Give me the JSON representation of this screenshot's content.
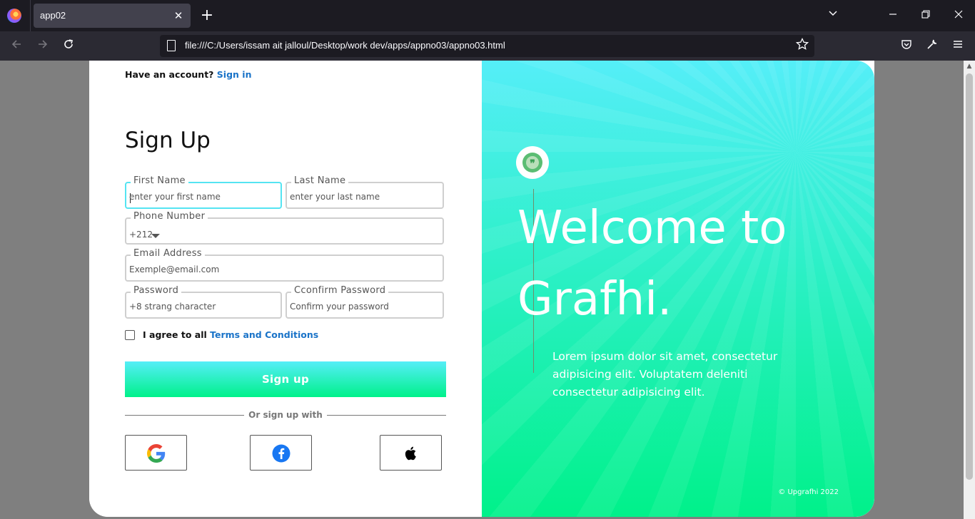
{
  "browser": {
    "tab_title": "app02",
    "tab_close": "✕",
    "new_tab": "+",
    "url": "file:///C:/Users/issam ait jalloul/Desktop/work dev/apps/appno03/appno03.html",
    "icons": [
      "firefox-logo",
      "back-arrow",
      "forward-arrow",
      "reload",
      "page-icon",
      "bookmark-star",
      "pocket",
      "wrench",
      "hamburger-menu",
      "list-tabs-chevron",
      "minimize",
      "restore",
      "close"
    ]
  },
  "form": {
    "have_account": "Have an account?",
    "sign_in": "Sign in",
    "title": "Sign Up",
    "first_name": {
      "label": "First Name",
      "placeholder": "enter your first name"
    },
    "last_name": {
      "label": "Last Name",
      "placeholder": "enter your last name"
    },
    "phone": {
      "label": "Phone Number",
      "code": "+212"
    },
    "email": {
      "label": "Email Address",
      "placeholder": "Exemple@email.com"
    },
    "password": {
      "label": "Password",
      "placeholder": "+8 strang character"
    },
    "confirm": {
      "label": "Cconfirm Password",
      "placeholder": "Confirm your password"
    },
    "agree_prefix": "I agree to all",
    "terms": "Terms and Conditions",
    "signup_button": "Sign up",
    "or_sign_up": "Or sign up with"
  },
  "hero": {
    "welcome": "Welcome to Grafhi.",
    "lorem": "Lorem ipsum dolor sit amet, consectetur adipisicing elit. Voluptatem deleniti consectetur adipisicing elit.",
    "copyright": "© Upgrafhi 2022"
  },
  "colors": {
    "accent_cyan": "#55eef8",
    "accent_green": "#00f18a",
    "link_blue": "#1a73c8"
  }
}
